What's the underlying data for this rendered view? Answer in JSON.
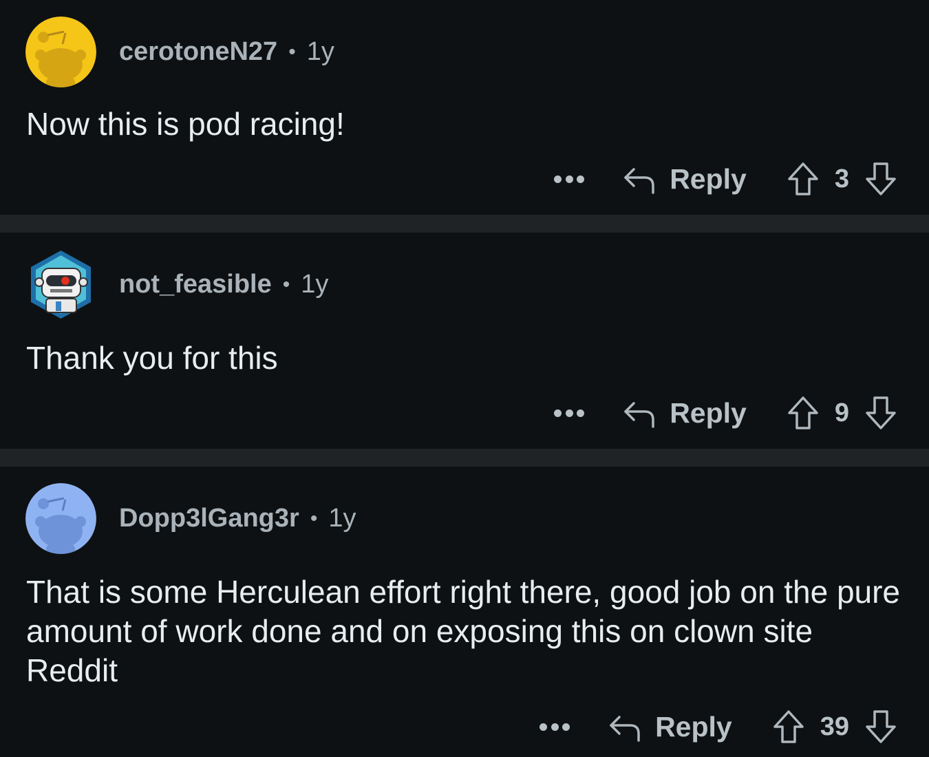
{
  "comments": [
    {
      "username": "cerotoneN27",
      "separator": "•",
      "age": "1y",
      "text": "Now this is pod racing!",
      "reply_label": "Reply",
      "score": "3",
      "avatar_color": "#f5c518",
      "avatar_icon": "snoo-avatar-icon"
    },
    {
      "username": "not_feasible",
      "separator": "•",
      "age": "1y",
      "text": "Thank you for this",
      "reply_label": "Reply",
      "score": "9",
      "avatar_color": "#2a9fd0",
      "avatar_icon": "robot-avatar-icon"
    },
    {
      "username": "Dopp3lGang3r",
      "separator": "•",
      "age": "1y",
      "text": "That is some Herculean effort right there, good job on the pure amount of work done and on exposing this on clown site Reddit",
      "reply_label": "Reply",
      "score": "39",
      "avatar_color": "#8fb3f2",
      "avatar_icon": "snoo-avatar-icon"
    }
  ],
  "colors": {
    "background": "#0e1113",
    "separator": "#1f2325",
    "meta_text": "#a9b3b9",
    "body_text": "#e8edef"
  }
}
